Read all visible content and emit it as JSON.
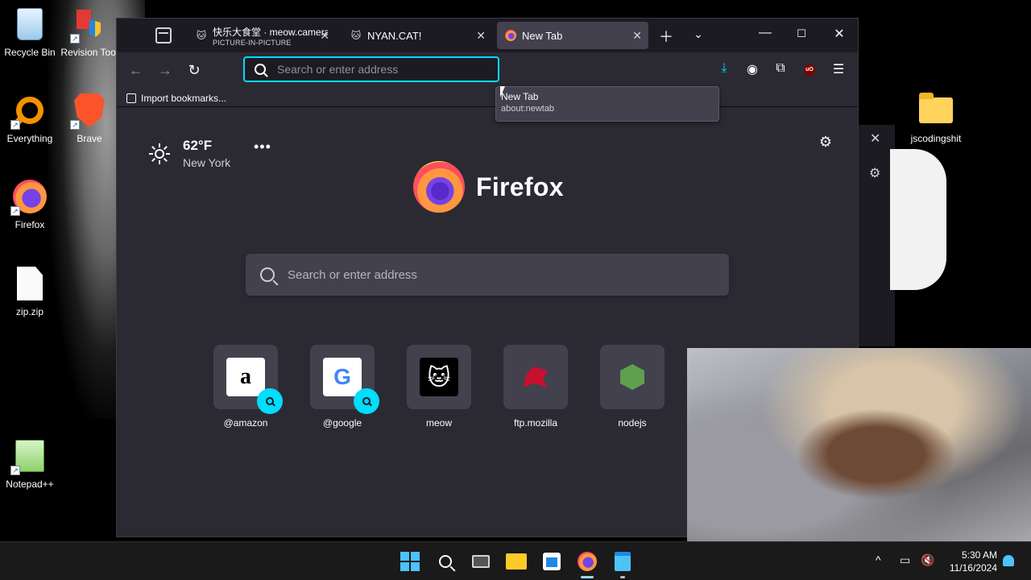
{
  "desktop": {
    "icons": [
      {
        "label": "Recycle Bin"
      },
      {
        "label": "Revision Tool"
      },
      {
        "label": "Everything"
      },
      {
        "label": "Brave"
      },
      {
        "label": "Firefox"
      },
      {
        "label": "zip.zip"
      },
      {
        "label": "Notepad++"
      },
      {
        "label": "jscodingshit"
      }
    ]
  },
  "browser": {
    "tabs": [
      {
        "title": "快乐大食堂 · meow.camera",
        "subtitle": "PICTURE-IN-PICTURE",
        "icon": "cat-icon"
      },
      {
        "title": "NYAN.CAT!",
        "icon": "cat-icon"
      },
      {
        "title": "New Tab",
        "icon": "firefox-icon",
        "active": true
      }
    ],
    "urlbar": {
      "placeholder": "Search or enter address",
      "value": ""
    },
    "tooltip": {
      "title": "New Tab",
      "url": "about:newtab"
    },
    "bookmarks": [
      {
        "label": "Import bookmarks..."
      }
    ]
  },
  "newtab": {
    "weather": {
      "temperature": "62°F",
      "city": "New York",
      "condition": "sunny"
    },
    "brand": "Firefox",
    "search_placeholder": "Search or enter address",
    "shortcuts": [
      {
        "label": "@amazon",
        "logo": "a",
        "search_shortcut": true
      },
      {
        "label": "@google",
        "logo": "G",
        "search_shortcut": true
      },
      {
        "label": "meow",
        "logo": "🐱",
        "search_shortcut": false
      },
      {
        "label": "ftp.mozilla",
        "logo": "",
        "search_shortcut": false
      },
      {
        "label": "nodejs",
        "logo": "",
        "search_shortcut": false
      }
    ]
  },
  "taskbar": {
    "clock": {
      "time": "5:30 AM",
      "date": "11/16/2024"
    },
    "tray": {
      "chevron": "^"
    }
  },
  "colors": {
    "accent": "#00ddff",
    "window_bg": "#2b2a33",
    "titlebar_bg": "#1c1b22",
    "card_bg": "#42414d",
    "taskbar_bg": "#1a1a1a"
  }
}
